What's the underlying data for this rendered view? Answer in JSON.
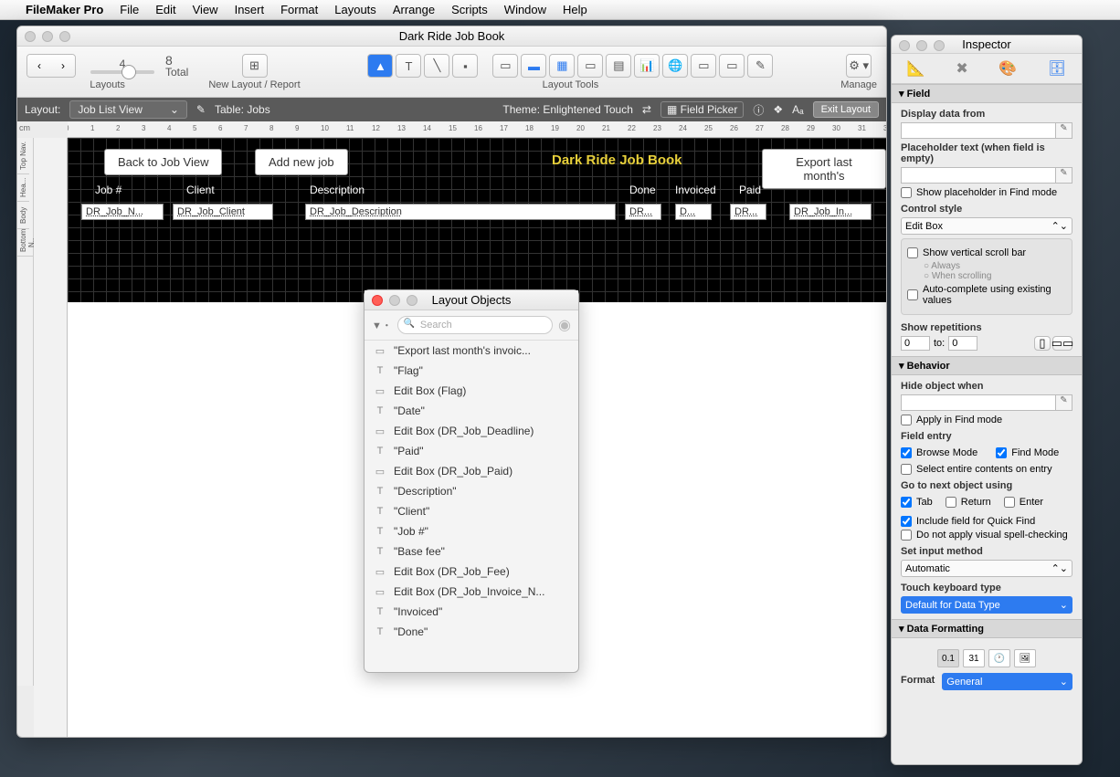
{
  "menubar": {
    "app": "FileMaker Pro",
    "items": [
      "File",
      "Edit",
      "View",
      "Insert",
      "Format",
      "Layouts",
      "Arrange",
      "Scripts",
      "Window",
      "Help"
    ]
  },
  "mainwin": {
    "title": "Dark Ride Job Book",
    "layouts_label": "Layouts",
    "newlayout_label": "New Layout / Report",
    "tools_label": "Layout Tools",
    "manage_label": "Manage",
    "record_count": "4",
    "record_total": "8",
    "total_label": "Total"
  },
  "layoutbar": {
    "layout_label": "Layout:",
    "layout_name": "Job List View",
    "table_label": "Table: Jobs",
    "theme_label": "Theme: Enlightened Touch",
    "fieldpicker": "Field Picker",
    "exit": "Exit Layout"
  },
  "ruler_cm": "cm",
  "canvas": {
    "btn_back": "Back to Job View",
    "btn_add": "Add new job",
    "btn_export": "Export last month's",
    "heading": "Dark Ride Job Book",
    "cols": [
      "Job #",
      "Client",
      "Description",
      "Done",
      "Invoiced",
      "Paid"
    ],
    "fields": [
      "DR_Job_N...",
      "DR_Job_Client",
      "DR_Job_Description",
      "DR...",
      "D...",
      "DR...",
      "DR_Job_In..."
    ]
  },
  "objpanel": {
    "title": "Layout Objects",
    "search_ph": "Search",
    "items": [
      {
        "icon": "▭",
        "label": "\"Export last month's invoic..."
      },
      {
        "icon": "T",
        "label": "\"Flag\""
      },
      {
        "icon": "▭",
        "label": "Edit Box (Flag)"
      },
      {
        "icon": "T",
        "label": "\"Date\""
      },
      {
        "icon": "▭",
        "label": "Edit Box (DR_Job_Deadline)"
      },
      {
        "icon": "T",
        "label": "\"Paid\""
      },
      {
        "icon": "▭",
        "label": "Edit Box (DR_Job_Paid)"
      },
      {
        "icon": "T",
        "label": "\"Description\""
      },
      {
        "icon": "T",
        "label": "\"Client\""
      },
      {
        "icon": "T",
        "label": "\"Job #\""
      },
      {
        "icon": "T",
        "label": "\"Base fee\""
      },
      {
        "icon": "▭",
        "label": "Edit Box (DR_Job_Fee)"
      },
      {
        "icon": "▭",
        "label": "Edit Box (DR_Job_Invoice_N..."
      },
      {
        "icon": "T",
        "label": "\"Invoiced\""
      },
      {
        "icon": "T",
        "label": "\"Done\""
      }
    ]
  },
  "inspector": {
    "title": "Inspector",
    "field_section": "Field",
    "display_label": "Display data from",
    "placeholder_label": "Placeholder text (when field is empty)",
    "show_ph_find": "Show placeholder in Find mode",
    "control_style_label": "Control style",
    "control_style_value": "Edit Box",
    "scroll_label": "Show vertical scroll bar",
    "always": "Always",
    "when_scrolling": "When scrolling",
    "autocomplete": "Auto-complete using existing values",
    "show_reps": "Show repetitions",
    "rep_from": "0",
    "rep_to_label": "to:",
    "rep_to": "0",
    "behavior_section": "Behavior",
    "hide_label": "Hide object when",
    "apply_find": "Apply in Find mode",
    "field_entry": "Field entry",
    "browse_mode": "Browse Mode",
    "find_mode": "Find Mode",
    "select_entire": "Select entire contents on entry",
    "goto_next": "Go to next object using",
    "tab": "Tab",
    "return": "Return",
    "enter": "Enter",
    "quickfind": "Include field for Quick Find",
    "spellcheck": "Do not apply visual spell-checking",
    "input_method": "Set input method",
    "input_method_val": "Automatic",
    "touch_kb": "Touch keyboard type",
    "touch_kb_val": "Default for Data Type",
    "datafmt_section": "Data Formatting",
    "format_label": "Format",
    "format_val": "General"
  }
}
